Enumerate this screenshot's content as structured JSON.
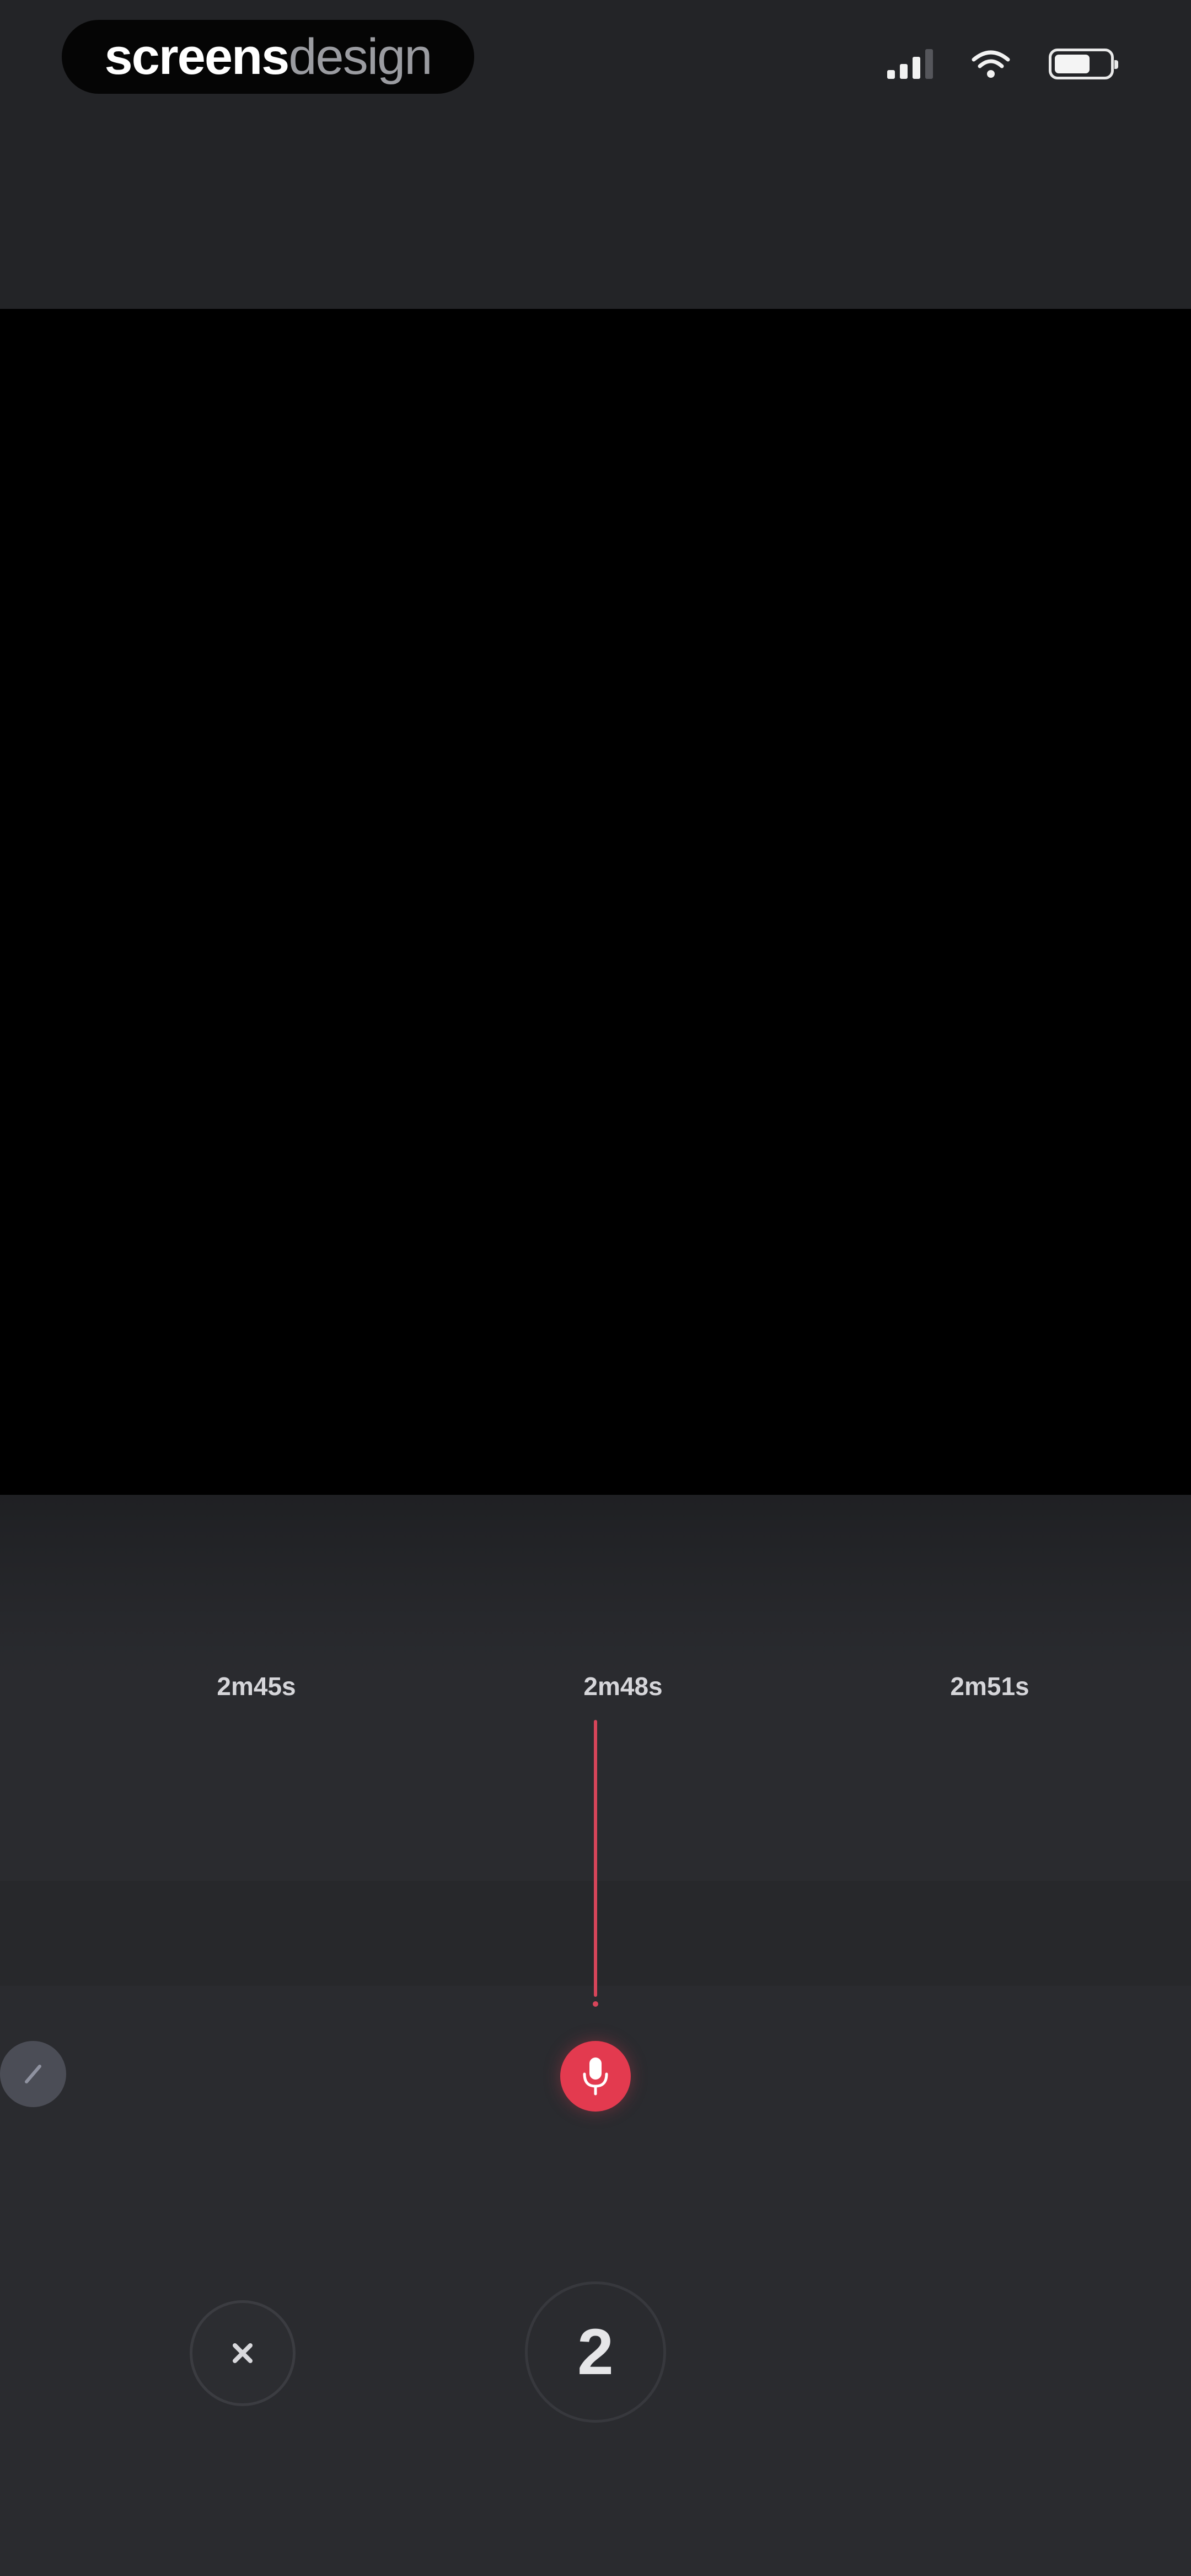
{
  "status_bar": {
    "brand_strong": "screens",
    "brand_light": "design",
    "icons": [
      "signal-icon",
      "wifi-icon",
      "battery-icon"
    ]
  },
  "timeline": {
    "ticks": [
      "2m45s",
      "2m48s",
      "2m51s"
    ]
  },
  "controls": {
    "left_handle_icon": "pencil-icon",
    "record_icon": "microphone-icon",
    "close_icon": "close-icon",
    "count": "2"
  },
  "colors": {
    "accent": "#e33a4f",
    "playhead": "#d7455a",
    "panel": "#2a2b2f",
    "preview": "#000000"
  }
}
